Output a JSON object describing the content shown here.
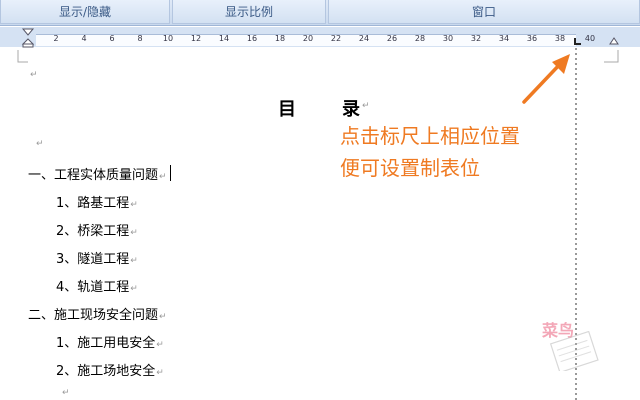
{
  "ribbon": {
    "groups": [
      "显示/隐藏",
      "显示比例",
      "窗口"
    ]
  },
  "ruler": {
    "ticks": [
      "2",
      "4",
      "6",
      "8",
      "10",
      "12",
      "14",
      "16",
      "18",
      "20",
      "22",
      "24",
      "26",
      "28",
      "30",
      "32",
      "34",
      "36",
      "38",
      "40"
    ]
  },
  "document": {
    "title_left": "目",
    "title_right": "录",
    "paragraph_mark": "↵",
    "lines": {
      "l1": "一、工程实体质量问题",
      "l2": "1、路基工程",
      "l3": "2、桥梁工程",
      "l4": "3、隧道工程",
      "l5": "4、轨道工程",
      "l6": "二、施工现场安全问题",
      "l7": "1、施工用电安全",
      "l8": "2、施工场地安全"
    }
  },
  "annotation": {
    "line1": "点击标尺上相应位置",
    "line2": "便可设置制表位",
    "color": "#ef7a22"
  },
  "watermark": "菜鸟"
}
